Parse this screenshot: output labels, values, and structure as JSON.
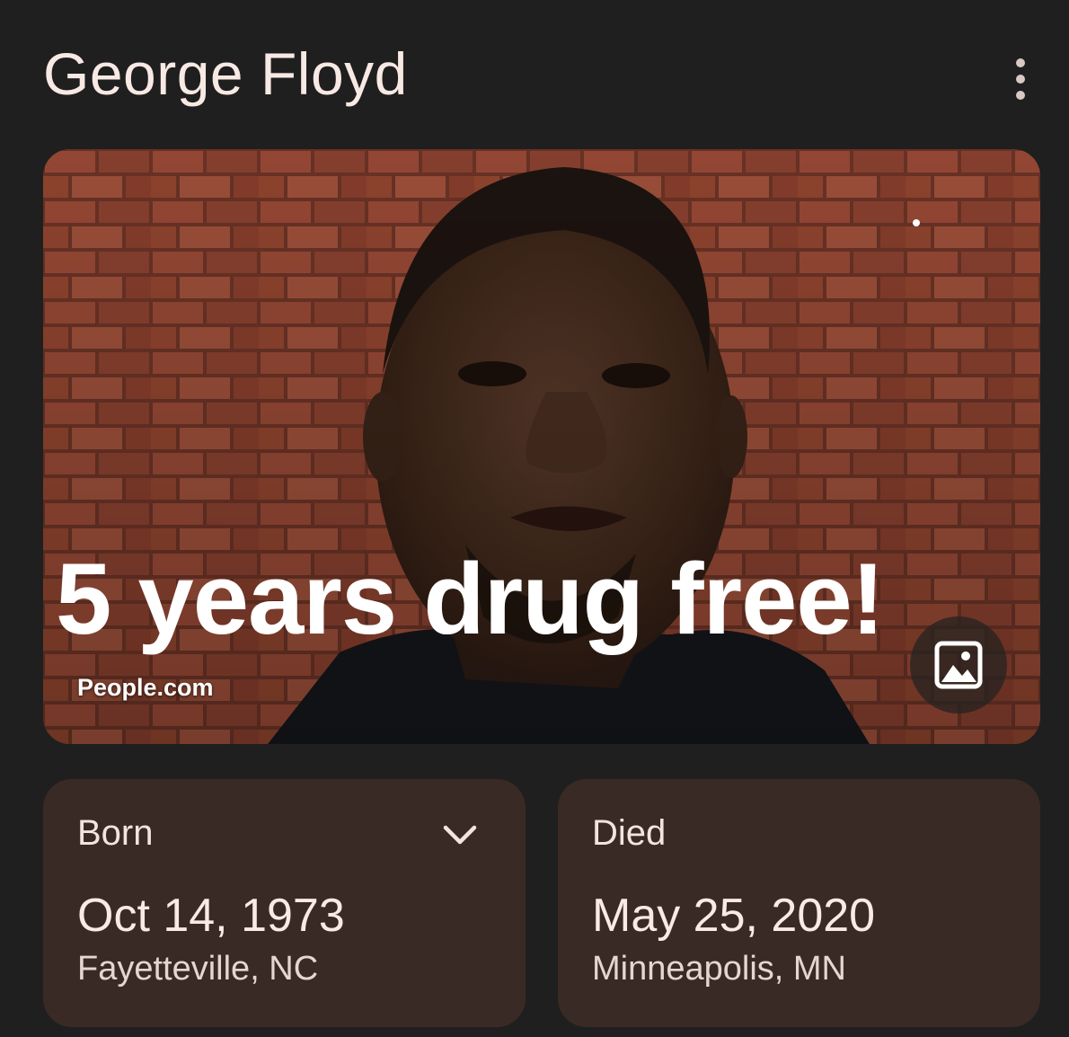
{
  "header": {
    "title": "George Floyd",
    "more_icon": "more-vert-icon"
  },
  "image": {
    "overlay_text": "5 years drug free!",
    "source": "People.com",
    "gallery_icon": "image-gallery-icon"
  },
  "born": {
    "label": "Born",
    "date": "Oct 14, 1973",
    "place": "Fayetteville, NC",
    "expand_icon": "chevron-down-icon"
  },
  "died": {
    "label": "Died",
    "date": "May 25, 2020",
    "place": "Minneapolis, MN"
  },
  "colors": {
    "background": "#1f1f1f",
    "card": "#3a2a25",
    "text": "#f8e9e4"
  }
}
